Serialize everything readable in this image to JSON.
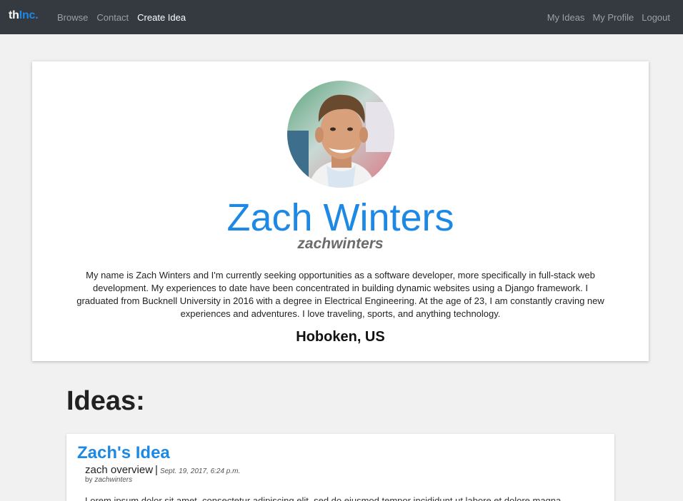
{
  "navbar": {
    "brand": {
      "part1": "th",
      "part2": "Inc."
    },
    "left_links": [
      {
        "label": "Browse"
      },
      {
        "label": "Contact"
      },
      {
        "label": "Create Idea"
      }
    ],
    "right_links": [
      {
        "label": "My Ideas"
      },
      {
        "label": "My Profile"
      },
      {
        "label": "Logout"
      }
    ]
  },
  "profile": {
    "name": "Zach Winters",
    "username": "zachwinters",
    "bio": "My name is Zach Winters and I'm currently seeking opportunities as a software developer, more specifically in full-stack web development. My experiences to date have been concentrated in building dynamic websites using a Django framework. I graduated from Bucknell University in 2016 with a degree in Electrical Engineering. At the age of 23, I am constantly craving new experiences and adventures. I love traveling, sports, and anything technology.",
    "location": "Hoboken, US"
  },
  "ideas": {
    "heading": "Ideas:",
    "items": [
      {
        "title": "Zach's Idea",
        "overview": "zach overview",
        "separator": "|",
        "date": "Sept. 19, 2017, 6:24 p.m.",
        "by_label": "by",
        "author": "zachwinters",
        "body": "Lorem ipsum dolor sit amet, consectetur adipiscing elit, sed do eiusmod tempor incididunt ut labore et dolore magna"
      }
    ]
  },
  "colors": {
    "navbar_bg": "#343a40",
    "accent": "#1e88e5",
    "page_bg": "#f1f1f1"
  }
}
